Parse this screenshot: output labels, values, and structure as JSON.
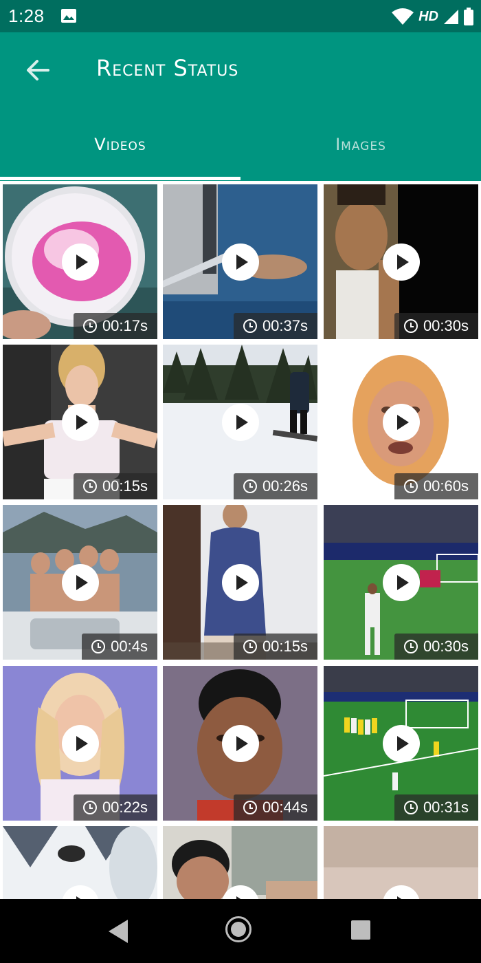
{
  "status_bar": {
    "time": "1:28",
    "network": "HD"
  },
  "header": {
    "title": "Recent Status"
  },
  "tabs": [
    {
      "label": "Videos"
    },
    {
      "label": "Images"
    }
  ],
  "videos": [
    {
      "duration": "00:17s"
    },
    {
      "duration": "00:37s"
    },
    {
      "duration": "00:30s"
    },
    {
      "duration": "00:15s"
    },
    {
      "duration": "00:26s"
    },
    {
      "duration": "00:60s"
    },
    {
      "duration": "00:4s"
    },
    {
      "duration": "00:15s"
    },
    {
      "duration": "00:30s"
    },
    {
      "duration": "00:22s"
    },
    {
      "duration": "00:44s"
    },
    {
      "duration": "00:31s"
    },
    {
      "duration": ""
    },
    {
      "duration": ""
    },
    {
      "duration": ""
    }
  ],
  "colors": {
    "status_bar": "#006e5f",
    "app_bar": "#009580",
    "tab_active": "#ffffff",
    "tab_inactive": "#b8e0d9"
  }
}
